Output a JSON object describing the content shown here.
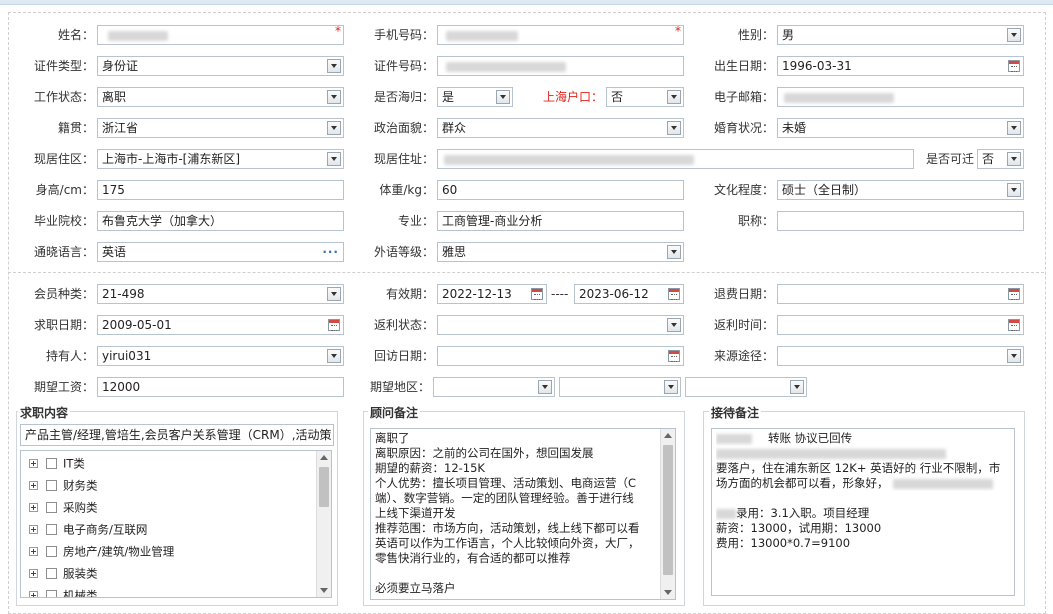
{
  "labels": {
    "name": "姓名：",
    "phone": "手机号码：",
    "gender": "性别：",
    "id_type": "证件类型：",
    "id_no": "证件号码：",
    "birth": "出生日期：",
    "work_status": "工作状态：",
    "returnee": "是否海归：",
    "sh_hukou": "上海户口：",
    "email": "电子邮箱：",
    "native": "籍贯：",
    "political": "政治面貌：",
    "marital": "婚育状况：",
    "cur_area": "现居住区：",
    "cur_addr": "现居住址：",
    "relocate": "是否可迁",
    "height": "身高/cm：",
    "weight": "体重/kg：",
    "education": "文化程度：",
    "school": "毕业院校：",
    "major": "专业：",
    "title": "职称：",
    "language": "通晓语言：",
    "foreign_level": "外语等级：",
    "member_type": "会员种类：",
    "valid": "有效期：",
    "refund_date": "退费日期：",
    "job_date": "求职日期：",
    "rebate_status": "返利状态：",
    "rebate_time": "返利时间：",
    "holder": "持有人：",
    "visit_date": "回访日期：",
    "source": "来源途径：",
    "salary": "期望工资：",
    "area": "期望地区："
  },
  "values": {
    "gender": "男",
    "id_type": "身份证",
    "birth": "1996-03-31",
    "work_status": "离职",
    "returnee": "是",
    "sh_hukou": "否",
    "native": "浙江省",
    "political": "群众",
    "marital": "未婚",
    "cur_area": "上海市-上海市-[浦东新区]",
    "relocate": "否",
    "height": "175",
    "weight": "60",
    "education": "硕士（全日制）",
    "school": "布鲁克大学（加拿大）",
    "major": "工商管理-商业分析",
    "title": "",
    "language": "英语",
    "foreign_level": "雅思",
    "member_type": "21-498",
    "valid_from": "2022-12-13",
    "valid_sep": "----",
    "valid_to": "2023-06-12",
    "refund_date": "",
    "job_date": "2009-05-01",
    "rebate_status": "",
    "rebate_time": "",
    "holder": "yirui031",
    "visit_date": "",
    "source": "",
    "salary": "12000"
  },
  "panels": {
    "job_content": {
      "title": "求职内容",
      "summary": "产品主管/经理,管培生,会员客户关系管理（CRM）,活动策",
      "items": [
        "IT类",
        "财务类",
        "采购类",
        "电子商务/互联网",
        "房地产/建筑/物业管理",
        "服装类",
        "机械类"
      ]
    },
    "consultant_note": {
      "title": "顾问备注",
      "lines": [
        "离职了",
        "离职原因：之前的公司在国外，想回国发展",
        "期望的薪资：12-15K",
        "个人优势：擅长项目管理、活动策划、电商运营（C",
        "端）、数字营销。一定的团队管理经验。善于进行线",
        "上线下渠道开发",
        "推荐范围：市场方向，活动策划，线上线下都可以看",
        "英语可以作为工作语言，个人比较倾向外资，大厂，",
        "零售快消行业的，有合适的都可以推荐",
        "",
        "必须要立马落户"
      ]
    },
    "reception_note": {
      "title": "接待备注",
      "lines": [
        "转账   协议已回传",
        "",
        "要落户，住在浦东新区 12K+ 英语好的 行业不限制，市",
        "场方面的机会都可以看，形象好，",
        "",
        "录用：3.1入职。项目经理",
        "薪资：13000，试用期：13000",
        "费用：13000*0.7=9100"
      ]
    }
  },
  "icons": {
    "dropdown": "chevron-down-icon",
    "calendar": "calendar-icon",
    "more": "ellipsis-icon",
    "expand": "plus-icon"
  },
  "colors": {
    "required": "#e2231a",
    "border": "#b7c3cf"
  }
}
